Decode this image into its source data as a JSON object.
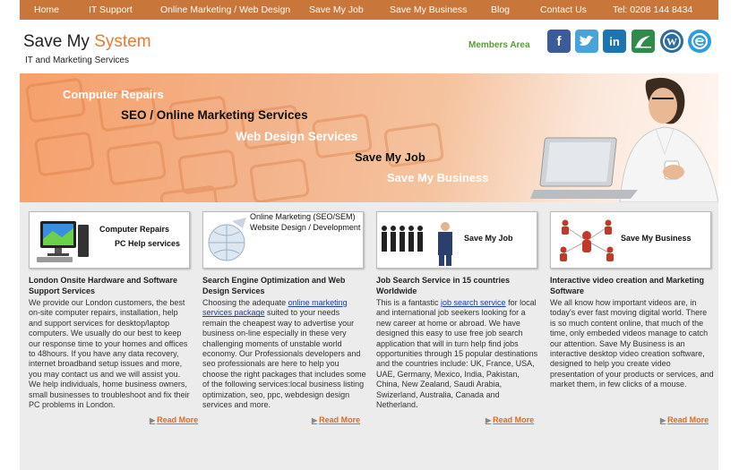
{
  "nav": {
    "items": [
      "Home",
      "IT Support",
      "Online Marketing / Web Design",
      "Save My Job",
      "Save My Business",
      "Blog",
      "Contact Us",
      "Tel: 0208 144 8434"
    ]
  },
  "header": {
    "title_prefix": "Save My ",
    "title_accent": "System",
    "subtitle": "IT and Marketing Services",
    "members_link": "Members Area",
    "social_icons": [
      "facebook-icon",
      "twitter-icon",
      "linkedin-icon",
      "blog-icon",
      "wordpress-icon",
      "ecademy-icon"
    ]
  },
  "banner": {
    "lines": [
      "Computer Repairs",
      "SEO / Online Marketing Services",
      "Web Design Services",
      "Save My Job",
      "Save My Business"
    ]
  },
  "columns": [
    {
      "card_lines": [
        "Computer Repairs",
        "PC Help services"
      ],
      "title": "London Onsite Hardware and Software Support Services",
      "text_before": "We provide our London customers, the best on-site computer repairs, installation, help and support services for desktop/laptop computers. We usually do our best to keep our response time to your homes and offices to 48hours. If you have any data recovery, internet broadband setup issues and more, you may contact us and we will assist you. We help individuals, home business owners, small businesses to troubleshoot and fix their PC problems in London.",
      "link": "",
      "text_after": "",
      "read_more": "Read More"
    },
    {
      "card_lines": [
        "Online Marketing (SEO/SEM)",
        "Website Design / Development"
      ],
      "title": "Search Engine Optimization and Web Design Services",
      "text_before": "Choosing the adequate ",
      "link": "online marketing services package",
      "text_after": " suited to your needs remain the cheapest way to advertise your business on-line especially in these very challenging moments of unstable world economy. Our Professionals developers and seo professionals are here to help you choose the right packages that includes some of the following services:local business listing optimization, seo, ppc, webdesign design services and more.",
      "read_more": "Read More"
    },
    {
      "card_lines": [
        "Save My Job"
      ],
      "title": "Job Search Service in 15 countries Worldwide",
      "text_before": "This is a fantastic ",
      "link": "job search service",
      "text_after": " for local and international job seekers looking for a new career at home or abroad. We have designed this easy to use free job search application that will in turn help find jobs opportunities through 15 popular destinations and the countries include: UK, France, USA, UAE, Germany, Mexico, India, Pakistan, China, New Zealand, Saudi Arabia, Swizerland, Australia, Canada and Netherland.",
      "read_more": "Read More"
    },
    {
      "card_lines": [
        "Save My Business"
      ],
      "title": "Interactive video creation and Marketing Software",
      "text_before": "We all know how important videos are, in today's ever fast moving digital world. There is so much content online, that much of the time, only embeded videos manage to catch our attention. Save My Business is an interactive desktop video creation software, designed to help you create video presentation of your products or services, and market them, in few clicks of a mouse.",
      "link": "",
      "text_after": "",
      "read_more": "Read More"
    }
  ],
  "colors": {
    "nav_bg": "#c8763a",
    "accent": "#e8792f",
    "members": "#5a9a3a",
    "link": "#1a3fb0",
    "read_more": "#e06a1f"
  }
}
